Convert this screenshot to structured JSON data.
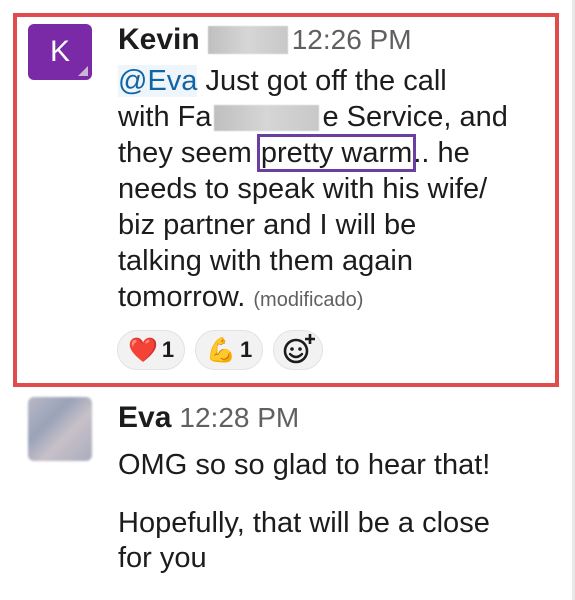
{
  "message1": {
    "avatar_letter": "K",
    "author": "Kevin",
    "time": "12:26 PM",
    "mention": "@Eva",
    "text_a": " Just got off the call",
    "text_b_prefix": "with Fa",
    "text_b_suffix": "e Service, and",
    "text_c_prefix": "they seem ",
    "highlight": "pretty warm",
    "text_c_suffix": ".. he",
    "line4": "needs to speak with his wife/",
    "line5": "biz partner and I will be",
    "line6": "talking with them again",
    "line7": "tomorrow.",
    "edited": "(modificado)",
    "reactions": [
      {
        "emoji": "❤️",
        "icon": "heart-icon",
        "count": "1"
      },
      {
        "emoji": "💪",
        "icon": "flexed-biceps-icon",
        "count": "1"
      }
    ],
    "add_reaction_icon": "add-emoji-icon"
  },
  "message2": {
    "author": "Eva",
    "time": "12:28 PM",
    "line1": "OMG so so glad to hear that!",
    "line2": "Hopefully, that will be a close",
    "line3": "for you"
  },
  "colors": {
    "frame": "#e04b4b",
    "avatar_k": "#7a2aa6",
    "mention": "#1264a3",
    "highlight_box": "#6a3fa0"
  }
}
